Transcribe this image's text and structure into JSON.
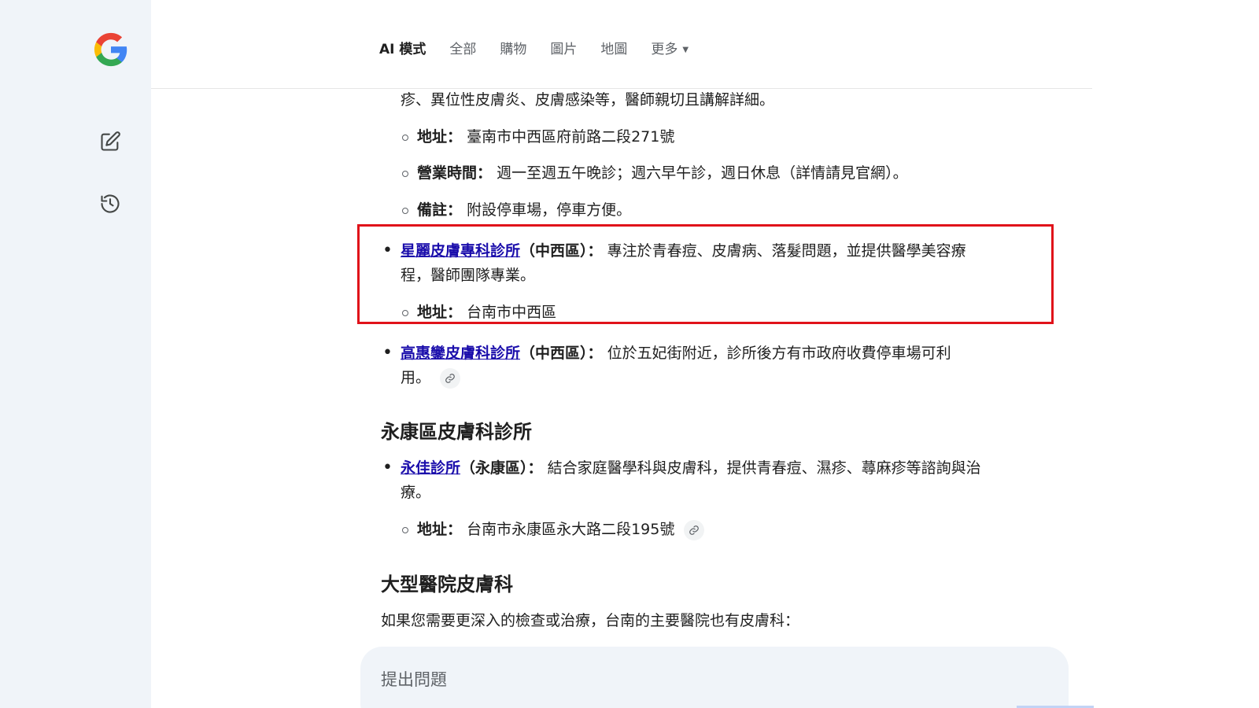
{
  "colors": {
    "sidebar_bg": "#f0f4f9",
    "link": "#1a0dab",
    "highlight_border": "#e0121a",
    "text": "#1f1f1f",
    "muted": "#5f6368"
  },
  "sidebar": {
    "logo_icon": "google-g-logo",
    "new_chat_icon": "edit-icon",
    "history_icon": "history-icon"
  },
  "tabs": [
    {
      "label": "AI 模式",
      "active": true
    },
    {
      "label": "全部"
    },
    {
      "label": "購物"
    },
    {
      "label": "圖片"
    },
    {
      "label": "地圖"
    },
    {
      "label": "更多"
    }
  ],
  "content": {
    "cont_line": "疹、異位性皮膚炎、皮膚感染等，醫師親切且講解詳細。",
    "clinic_prev": {
      "addr_label": "地址：",
      "addr_value": "臺南市中西區府前路二段271號",
      "hours_label": "營業時間：",
      "hours_value": "週一至週五午晚診；週六早午診，週日休息（詳情請見官網）。",
      "note_label": "備註：",
      "note_value": "附設停車場，停車方便。"
    },
    "clinic_xingli": {
      "name": "星麗皮膚專科診所",
      "district": "（中西區）：",
      "desc_1": "專注於青春痘、皮膚病、落髮問題，並提供醫學美容療",
      "desc_2": "程，醫師團隊專業。",
      "addr_label": "地址：",
      "addr_value": "台南市中西區"
    },
    "clinic_gao": {
      "name": "高惠鑾皮膚科診所",
      "district": "（中西區）：",
      "desc_1": "位於五妃街附近，診所後方有市政府收費停車場可利",
      "desc_2": "用。"
    },
    "section_yongkang": "永康區皮膚科診所",
    "clinic_yongjia": {
      "name": "永佳診所",
      "district": "（永康區）：",
      "desc_1": "結合家庭醫學科與皮膚科，提供青春痘、濕疹、蕁麻疹等諮詢與治",
      "desc_2": "療。",
      "addr_label": "地址：",
      "addr_value": "台南市永康區永大路二段195號"
    },
    "section_hospital": "大型醫院皮膚科",
    "hospital_intro": "如果您需要更深入的檢查或治療，台南的主要醫院也有皮膚科："
  },
  "ask": {
    "placeholder": "提出問題"
  }
}
